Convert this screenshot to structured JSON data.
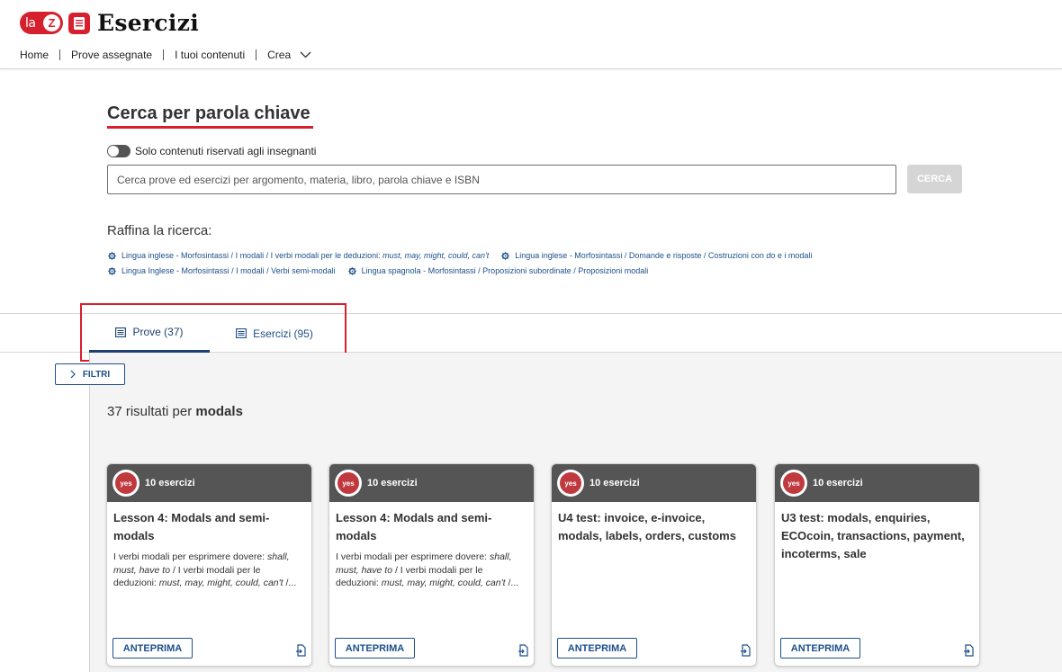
{
  "brand": {
    "logo_la": "la",
    "logo_z": "Z",
    "app_title": "Esercizi"
  },
  "nav": {
    "items": [
      "Home",
      "Prove assegnate",
      "I tuoi contenuti",
      "Crea"
    ]
  },
  "search": {
    "title": "Cerca per parola chiave",
    "toggle_label": "Solo contenuti riservati agli insegnanti",
    "placeholder": "Cerca prove ed esercizi per argomento, materia, libro, parola chiave e ISBN",
    "button_label": "CERCA"
  },
  "refine": {
    "title": "Raffina la ricerca:",
    "items": [
      {
        "prefix": "Lingua inglese - Morfosintassi / I modali / I verbi modali per le deduzioni: ",
        "italic": "must, may, might, could, can't",
        "suffix": ""
      },
      {
        "prefix": "Lingua inglese - Morfosintassi / Domande e risposte / Costruzioni con ",
        "italic": "do",
        "suffix": " e i modali"
      },
      {
        "prefix": "Lingua Inglese - Morfosintassi / I modali / Verbi semi-modali",
        "italic": "",
        "suffix": ""
      },
      {
        "prefix": "Lingua spagnola - Morfosintassi / Proposizioni subordinate / Proposizioni modali",
        "italic": "",
        "suffix": ""
      }
    ]
  },
  "tabs": [
    {
      "label": "Prove (37)",
      "active": true
    },
    {
      "label": "Esercizi (95)",
      "active": false
    }
  ],
  "filters": {
    "button_label": "FILTRI"
  },
  "results": {
    "count_prefix": "37 risultati per ",
    "keyword": "modals"
  },
  "cards": [
    {
      "badge": "10 esercizi",
      "title": "Lesson 4: Modals and semi-modals",
      "desc": [
        {
          "t": "I verbi modali per esprimere dovere: ",
          "i": false
        },
        {
          "t": "shall, must, have to",
          "i": true
        },
        {
          "t": " / I verbi modali per le deduzioni: ",
          "i": false
        },
        {
          "t": "must, may, might, could, can't",
          "i": true
        },
        {
          "t": " /...",
          "i": false
        }
      ],
      "preview_label": "ANTEPRIMA"
    },
    {
      "badge": "10 esercizi",
      "title": "Lesson 4: Modals and semi-modals",
      "desc": [
        {
          "t": "I verbi modali per esprimere dovere: ",
          "i": false
        },
        {
          "t": "shall, must, have to",
          "i": true
        },
        {
          "t": " / I verbi modali per le deduzioni: ",
          "i": false
        },
        {
          "t": "must, may, might, could, can't",
          "i": true
        },
        {
          "t": " /...",
          "i": false
        }
      ],
      "preview_label": "ANTEPRIMA"
    },
    {
      "badge": "10 esercizi",
      "title": "U4 test: invoice, e-invoice, modals, labels, orders, customs",
      "desc": [],
      "preview_label": "ANTEPRIMA"
    },
    {
      "badge": "10 esercizi",
      "title": "U3 test: modals, enquiries, ECOcoin, transactions, payment, incoterms, sale",
      "desc": [],
      "preview_label": "ANTEPRIMA"
    }
  ],
  "colors": {
    "brand_red": "#d6202e",
    "link_blue": "#1d4f8c",
    "card_header": "#555555",
    "button_disabled": "#d5d5d5"
  },
  "icons": {
    "tab_icon": "list-icon",
    "refine_icon": "gear-icon",
    "filter_icon": "chevron-right-icon",
    "card_badge_icon": "exercise-badge-icon",
    "card_action_icon": "assign-icon",
    "nav_dropdown_icon": "chevron-down-icon"
  }
}
